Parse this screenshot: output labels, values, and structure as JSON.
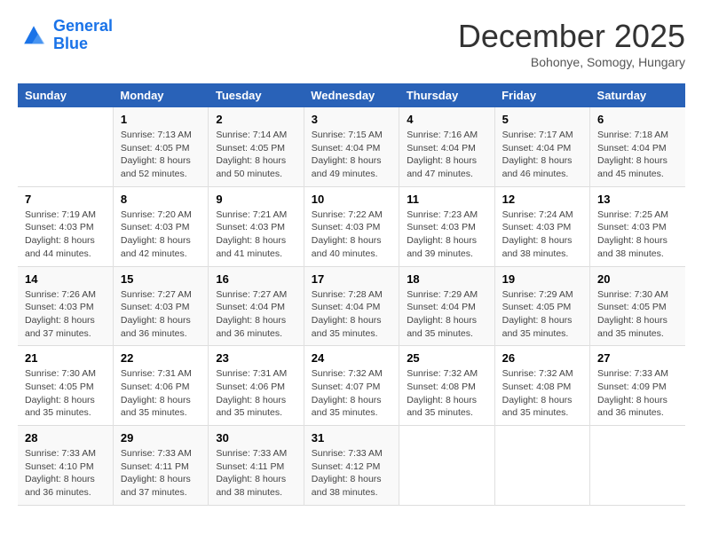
{
  "logo": {
    "line1": "General",
    "line2": "Blue"
  },
  "title": "December 2025",
  "subtitle": "Bohonye, Somogy, Hungary",
  "weekdays": [
    "Sunday",
    "Monday",
    "Tuesday",
    "Wednesday",
    "Thursday",
    "Friday",
    "Saturday"
  ],
  "weeks": [
    [
      {
        "day": "",
        "sunrise": "",
        "sunset": "",
        "daylight": ""
      },
      {
        "day": "1",
        "sunrise": "Sunrise: 7:13 AM",
        "sunset": "Sunset: 4:05 PM",
        "daylight": "Daylight: 8 hours and 52 minutes."
      },
      {
        "day": "2",
        "sunrise": "Sunrise: 7:14 AM",
        "sunset": "Sunset: 4:05 PM",
        "daylight": "Daylight: 8 hours and 50 minutes."
      },
      {
        "day": "3",
        "sunrise": "Sunrise: 7:15 AM",
        "sunset": "Sunset: 4:04 PM",
        "daylight": "Daylight: 8 hours and 49 minutes."
      },
      {
        "day": "4",
        "sunrise": "Sunrise: 7:16 AM",
        "sunset": "Sunset: 4:04 PM",
        "daylight": "Daylight: 8 hours and 47 minutes."
      },
      {
        "day": "5",
        "sunrise": "Sunrise: 7:17 AM",
        "sunset": "Sunset: 4:04 PM",
        "daylight": "Daylight: 8 hours and 46 minutes."
      },
      {
        "day": "6",
        "sunrise": "Sunrise: 7:18 AM",
        "sunset": "Sunset: 4:04 PM",
        "daylight": "Daylight: 8 hours and 45 minutes."
      }
    ],
    [
      {
        "day": "7",
        "sunrise": "Sunrise: 7:19 AM",
        "sunset": "Sunset: 4:03 PM",
        "daylight": "Daylight: 8 hours and 44 minutes."
      },
      {
        "day": "8",
        "sunrise": "Sunrise: 7:20 AM",
        "sunset": "Sunset: 4:03 PM",
        "daylight": "Daylight: 8 hours and 42 minutes."
      },
      {
        "day": "9",
        "sunrise": "Sunrise: 7:21 AM",
        "sunset": "Sunset: 4:03 PM",
        "daylight": "Daylight: 8 hours and 41 minutes."
      },
      {
        "day": "10",
        "sunrise": "Sunrise: 7:22 AM",
        "sunset": "Sunset: 4:03 PM",
        "daylight": "Daylight: 8 hours and 40 minutes."
      },
      {
        "day": "11",
        "sunrise": "Sunrise: 7:23 AM",
        "sunset": "Sunset: 4:03 PM",
        "daylight": "Daylight: 8 hours and 39 minutes."
      },
      {
        "day": "12",
        "sunrise": "Sunrise: 7:24 AM",
        "sunset": "Sunset: 4:03 PM",
        "daylight": "Daylight: 8 hours and 38 minutes."
      },
      {
        "day": "13",
        "sunrise": "Sunrise: 7:25 AM",
        "sunset": "Sunset: 4:03 PM",
        "daylight": "Daylight: 8 hours and 38 minutes."
      }
    ],
    [
      {
        "day": "14",
        "sunrise": "Sunrise: 7:26 AM",
        "sunset": "Sunset: 4:03 PM",
        "daylight": "Daylight: 8 hours and 37 minutes."
      },
      {
        "day": "15",
        "sunrise": "Sunrise: 7:27 AM",
        "sunset": "Sunset: 4:03 PM",
        "daylight": "Daylight: 8 hours and 36 minutes."
      },
      {
        "day": "16",
        "sunrise": "Sunrise: 7:27 AM",
        "sunset": "Sunset: 4:04 PM",
        "daylight": "Daylight: 8 hours and 36 minutes."
      },
      {
        "day": "17",
        "sunrise": "Sunrise: 7:28 AM",
        "sunset": "Sunset: 4:04 PM",
        "daylight": "Daylight: 8 hours and 35 minutes."
      },
      {
        "day": "18",
        "sunrise": "Sunrise: 7:29 AM",
        "sunset": "Sunset: 4:04 PM",
        "daylight": "Daylight: 8 hours and 35 minutes."
      },
      {
        "day": "19",
        "sunrise": "Sunrise: 7:29 AM",
        "sunset": "Sunset: 4:05 PM",
        "daylight": "Daylight: 8 hours and 35 minutes."
      },
      {
        "day": "20",
        "sunrise": "Sunrise: 7:30 AM",
        "sunset": "Sunset: 4:05 PM",
        "daylight": "Daylight: 8 hours and 35 minutes."
      }
    ],
    [
      {
        "day": "21",
        "sunrise": "Sunrise: 7:30 AM",
        "sunset": "Sunset: 4:05 PM",
        "daylight": "Daylight: 8 hours and 35 minutes."
      },
      {
        "day": "22",
        "sunrise": "Sunrise: 7:31 AM",
        "sunset": "Sunset: 4:06 PM",
        "daylight": "Daylight: 8 hours and 35 minutes."
      },
      {
        "day": "23",
        "sunrise": "Sunrise: 7:31 AM",
        "sunset": "Sunset: 4:06 PM",
        "daylight": "Daylight: 8 hours and 35 minutes."
      },
      {
        "day": "24",
        "sunrise": "Sunrise: 7:32 AM",
        "sunset": "Sunset: 4:07 PM",
        "daylight": "Daylight: 8 hours and 35 minutes."
      },
      {
        "day": "25",
        "sunrise": "Sunrise: 7:32 AM",
        "sunset": "Sunset: 4:08 PM",
        "daylight": "Daylight: 8 hours and 35 minutes."
      },
      {
        "day": "26",
        "sunrise": "Sunrise: 7:32 AM",
        "sunset": "Sunset: 4:08 PM",
        "daylight": "Daylight: 8 hours and 35 minutes."
      },
      {
        "day": "27",
        "sunrise": "Sunrise: 7:33 AM",
        "sunset": "Sunset: 4:09 PM",
        "daylight": "Daylight: 8 hours and 36 minutes."
      }
    ],
    [
      {
        "day": "28",
        "sunrise": "Sunrise: 7:33 AM",
        "sunset": "Sunset: 4:10 PM",
        "daylight": "Daylight: 8 hours and 36 minutes."
      },
      {
        "day": "29",
        "sunrise": "Sunrise: 7:33 AM",
        "sunset": "Sunset: 4:11 PM",
        "daylight": "Daylight: 8 hours and 37 minutes."
      },
      {
        "day": "30",
        "sunrise": "Sunrise: 7:33 AM",
        "sunset": "Sunset: 4:11 PM",
        "daylight": "Daylight: 8 hours and 38 minutes."
      },
      {
        "day": "31",
        "sunrise": "Sunrise: 7:33 AM",
        "sunset": "Sunset: 4:12 PM",
        "daylight": "Daylight: 8 hours and 38 minutes."
      },
      {
        "day": "",
        "sunrise": "",
        "sunset": "",
        "daylight": ""
      },
      {
        "day": "",
        "sunrise": "",
        "sunset": "",
        "daylight": ""
      },
      {
        "day": "",
        "sunrise": "",
        "sunset": "",
        "daylight": ""
      }
    ]
  ]
}
